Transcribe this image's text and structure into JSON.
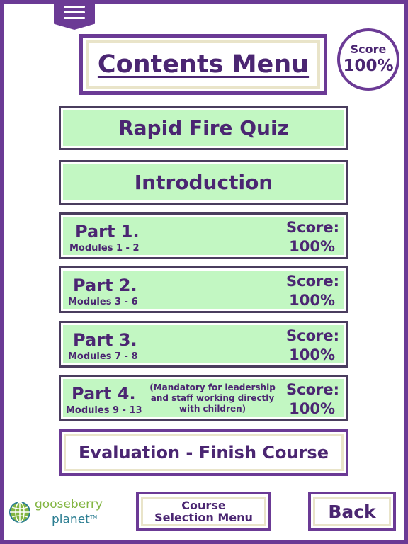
{
  "header": {
    "title": "Contents Menu",
    "score_label": "Score",
    "score_value": "100%"
  },
  "menu": {
    "rapid_fire": "Rapid Fire Quiz",
    "introduction": "Introduction",
    "parts": [
      {
        "title": "Part 1.",
        "modules": "Modules 1 - 2",
        "score_label": "Score:",
        "score_value": "100%"
      },
      {
        "title": "Part 2.",
        "modules": "Modules 3 - 6",
        "score_label": "Score:",
        "score_value": "100%"
      },
      {
        "title": "Part 3.",
        "modules": "Modules 7 - 8",
        "score_label": "Score:",
        "score_value": "100%"
      },
      {
        "title": "Part 4.",
        "modules": "Modules 9 - 13",
        "note": "(Mandatory for leadership and staff working directly with children)",
        "score_label": "Score:",
        "score_value": "100%"
      }
    ],
    "evaluation": "Evaluation - Finish Course"
  },
  "footer": {
    "logo_line1": "gooseberry",
    "logo_line2": "planet",
    "logo_tm": "TM",
    "course_selection": "Course Selection Menu",
    "back": "Back"
  },
  "colors": {
    "purple": "#6b3a95",
    "text_purple": "#4b2672",
    "green": "#c2f7c2",
    "logo_green": "#82b541",
    "logo_teal": "#2c7e92"
  },
  "icons": {
    "menu": "hamburger-icon",
    "logo": "globe-icon"
  }
}
